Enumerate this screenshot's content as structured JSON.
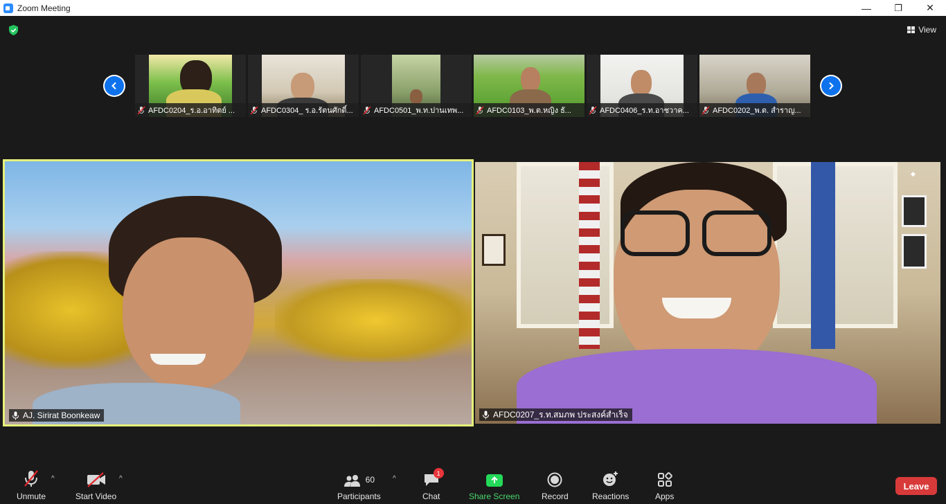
{
  "window": {
    "title": "Zoom Meeting",
    "minimize": "—",
    "restore": "❐",
    "close": "✕"
  },
  "top": {
    "view_label": "View"
  },
  "thumbnails": [
    {
      "name": "AFDC0204_ร.อ.อาทิตย์ ...",
      "bg": "#4b8a3c"
    },
    {
      "name": "AFDC0304_ ร.อ.รัตนศักดิ์...",
      "bg": "#cfc6b4"
    },
    {
      "name": "AFDC0501_พ.ท.ปานเทพ...",
      "bg": "#8a9a6a"
    },
    {
      "name": "AFDC0103_พ.ต.หญิง ธั...",
      "bg": "#6aa83c"
    },
    {
      "name": "AFDC0406_ร.ท.อาชวาค...",
      "bg": "#e8e8e4"
    },
    {
      "name": "AFDC0202_พ.ต. สำราญ...",
      "bg": "#b7b2a4"
    }
  ],
  "main": {
    "left_name": "AJ. Sirirat Boonkeaw",
    "right_name": "AFDC0207_ร.ท.สมภพ ประสงค์สำเร็จ"
  },
  "toolbar": {
    "unmute": "Unmute",
    "start_video": "Start Video",
    "participants_count": "60",
    "participants": "Participants",
    "chat": "Chat",
    "chat_badge": "1",
    "share_screen": "Share Screen",
    "record": "Record",
    "reactions": "Reactions",
    "apps": "Apps",
    "leave": "Leave"
  },
  "colors": {
    "accent_blue": "#0e72ed",
    "share_green": "#23d959",
    "leave_red": "#d83a3a",
    "active_speaker_border": "#e6f07a"
  }
}
